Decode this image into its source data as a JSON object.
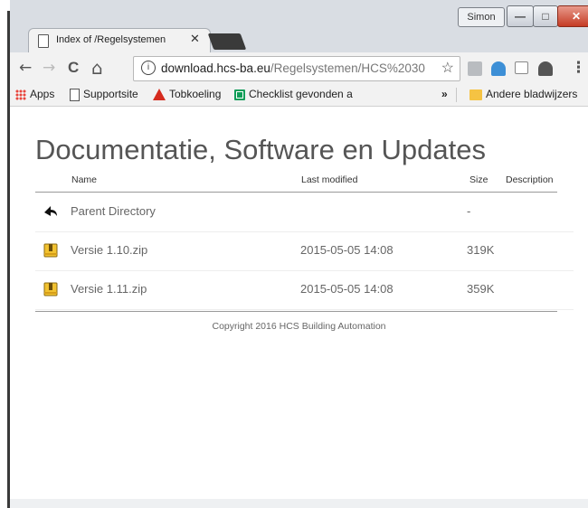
{
  "window": {
    "profile_name": "Simon",
    "controls": {
      "minimize": "—",
      "maximize": "□",
      "close": "✕"
    }
  },
  "tab": {
    "title": "Index of /Regelsystemen",
    "close": "✕"
  },
  "toolbar": {
    "back": "←",
    "forward": "→",
    "reload": "C",
    "home": "⌂",
    "info": "i",
    "url_host": "download.hcs-ba.eu",
    "url_path": "/Regelsystemen/HCS%2030",
    "star": "☆",
    "menu": "⋮"
  },
  "bookmarks": {
    "apps": "Apps",
    "items": [
      "Supportsite",
      "Tobkoeling",
      "Checklist gevonden a"
    ],
    "overflow": "»",
    "other": "Andere bladwijzers"
  },
  "page": {
    "title": "Documentatie, Software en Updates",
    "columns": {
      "name": "Name",
      "last_modified": "Last modified",
      "size": "Size",
      "description": "Description"
    },
    "rows": [
      {
        "name": "Parent Directory",
        "last_modified": "",
        "size": "-",
        "icon": "back-arrow-icon"
      },
      {
        "name": "Versie 1.10.zip",
        "last_modified": "2015-05-05 14:08",
        "size": "319K",
        "icon": "zip-archive-icon"
      },
      {
        "name": "Versie 1.11.zip",
        "last_modified": "2015-05-05 14:08",
        "size": "359K",
        "icon": "zip-archive-icon"
      }
    ],
    "footer": "Copyright 2016 HCS Building Automation"
  },
  "colors": {
    "titlebar": "#d9dde3",
    "toolbar": "#f2f2f2",
    "close_button": "#c53b24",
    "title_text": "#555555"
  }
}
